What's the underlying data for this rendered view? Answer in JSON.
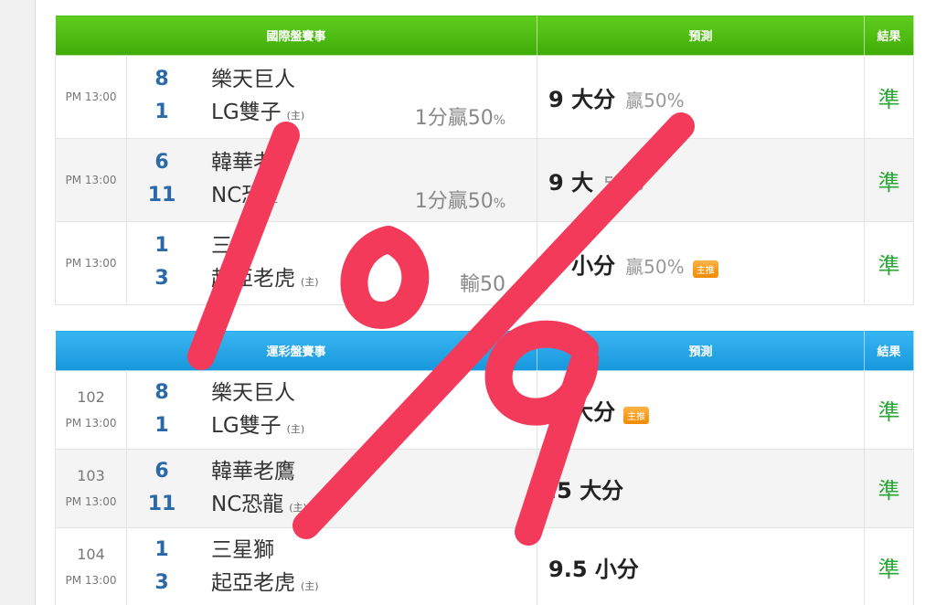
{
  "colors": {
    "section1_header": "#4cbb10",
    "section2_header": "#23a3e6",
    "score": "#2a6aa9",
    "result_text": "#29a635",
    "overlay_stroke": "#f33a5b"
  },
  "section1": {
    "headers": {
      "match": "國際盤賽事",
      "prediction": "預測",
      "result": "結果"
    },
    "rows": [
      {
        "time": "PM 13:00",
        "away_score": "8",
        "away_team": "樂天巨人",
        "home_score": "1",
        "home_team": "LG雙子",
        "home_mark": "(主)",
        "handicap": "1分贏50",
        "handicap_pct": "%",
        "pred": "9 大分",
        "pred_rate": "贏50%",
        "badge": "",
        "result": "準"
      },
      {
        "time": "PM 13:00",
        "away_score": "6",
        "away_team": "韓華老",
        "home_score": "11",
        "home_team": "NC恐",
        "home_mark": "主",
        "handicap": "1分贏50",
        "handicap_pct": "%",
        "pred": "9 大",
        "pred_rate": "50%",
        "badge": "",
        "result": "準"
      },
      {
        "time": "PM 13:00",
        "away_score": "1",
        "away_team": "三星",
        "home_score": "3",
        "home_team": "起亞老虎",
        "home_mark": "(主)",
        "handicap": "輸50",
        "handicap_pct": "",
        "pred": "9 小分",
        "pred_rate": "贏50%",
        "badge": "主推",
        "result": "準"
      }
    ]
  },
  "section2": {
    "headers": {
      "match": "運彩盤賽事",
      "prediction": "預測",
      "result": "結果"
    },
    "rows": [
      {
        "id": "102",
        "time": "PM 13:00",
        "away_score": "8",
        "away_team": "樂天巨人",
        "home_score": "1",
        "home_team": "LG雙子",
        "home_mark": "(主)",
        "pred": "8 大分",
        "badge": "主推",
        "result": "準"
      },
      {
        "id": "103",
        "time": "PM 13:00",
        "away_score": "6",
        "away_team": "韓華老鷹",
        "home_score": "11",
        "home_team": "NC恐龍",
        "home_mark": "(主)",
        "pred": ".5 大分",
        "badge": "",
        "result": "準"
      },
      {
        "id": "104",
        "time": "PM 13:00",
        "away_score": "1",
        "away_team": "三星獅",
        "home_score": "3",
        "home_team": "起亞老虎",
        "home_mark": "(主)",
        "pred": "9.5 小分",
        "badge": "",
        "result": "準"
      }
    ]
  }
}
